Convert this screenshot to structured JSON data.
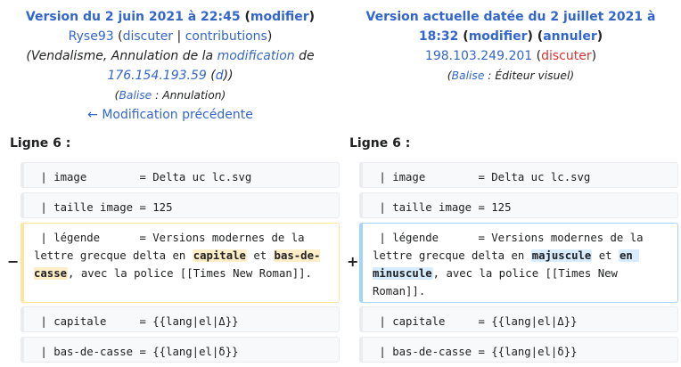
{
  "old": {
    "title": "Version du 2 juin 2021 à 22:45",
    "edit_link": "modifier",
    "user": "Ryse93",
    "talk": "discuter",
    "contribs": "contributions",
    "summary_prefix": "(Vendalisme, Annulation de la ",
    "summary_link": "modification",
    "summary_mid": " de ",
    "summary_ip": "176.154.193.59",
    "summary_d": "d",
    "tag_link": "Balise",
    "tag_text": " : Annulation",
    "prev_link": "← Modification précédente"
  },
  "new": {
    "title_line1": "Version actuelle datée du 2 juillet 2021 à",
    "title_line2": "18:32",
    "edit_link": "modifier",
    "undo_link": "annuler",
    "ip": "198.103.249.201",
    "talk": "discuter",
    "tag_link": "Balise",
    "tag_text": " : Éditeur visuel"
  },
  "diff": {
    "line_label": "Ligne 6 :",
    "del_marker": "−",
    "add_marker": "+",
    "rows": [
      {
        "left": " | image        = Delta uc lc.svg",
        "right": " | image        = Delta uc lc.svg"
      },
      {
        "left": " | taille image = 125",
        "right": " | taille image = 125"
      },
      {
        "left": " | capitale     = {{lang|el|Δ}}",
        "right": " | capitale     = {{lang|el|Δ}}"
      },
      {
        "left": " | bas-de-casse = {{lang|el|δ}}",
        "right": " | bas-de-casse = {{lang|el|δ}}"
      }
    ],
    "changed": {
      "left_a": " | légende      = Versions modernes de la lettre grecque delta en ",
      "left_m1": "capitale",
      "left_b": " et ",
      "left_m2": "bas-de-casse",
      "left_c": ", avec la police [[Times New Roman]].",
      "right_a": " | légende      = Versions modernes de la lettre grecque delta en ",
      "right_m1": "majuscule",
      "right_b": " et ",
      "right_m2": "en minuscule",
      "right_c": ", avec la police [[Times New Roman]]."
    }
  },
  "colors": {
    "link": "#3366cc",
    "red_link": "#d73333",
    "del_border": "#ffe49c",
    "add_border": "#a3d3ff"
  }
}
